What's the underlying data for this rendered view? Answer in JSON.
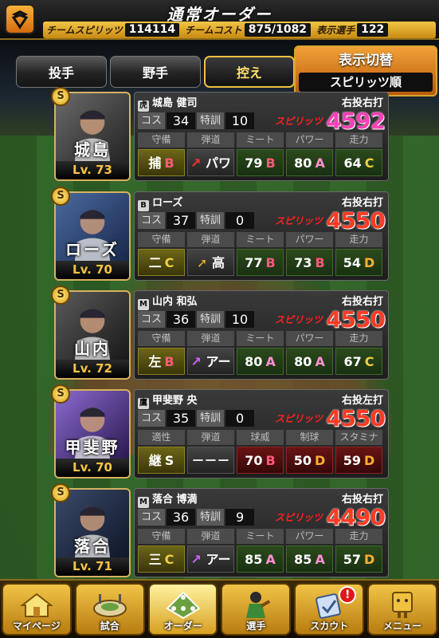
{
  "header": {
    "title": "通常オーダー",
    "team_spirits_label": "チームスピリッツ",
    "team_spirits_value": "114114",
    "team_cost_label": "チームコスト",
    "team_cost_value": "875/1082",
    "display_players_label": "表示選手",
    "display_players_value": "122"
  },
  "tabs": [
    {
      "label": "投手"
    },
    {
      "label": "野手"
    },
    {
      "label": "控え",
      "active": true
    }
  ],
  "sort_toggle": {
    "title": "表示切替",
    "value": "スピリッツ順"
  },
  "labels": {
    "cost": "コス",
    "training": "特訓",
    "spirits": "スピリッツ"
  },
  "players": [
    {
      "name": "城島",
      "level": "Lv. 73",
      "team_icon": "虎",
      "full_name": "城島 健司",
      "handedness": "右投右打",
      "cost": "34",
      "training": "10",
      "spirits": "4592",
      "spirits_color": "#ff3fb8",
      "headers": [
        "守備",
        "弾道",
        "ミート",
        "パワー",
        "走力"
      ],
      "values": [
        {
          "text": "捕",
          "grade": "B"
        },
        {
          "arrow": "↗",
          "text": "パワ"
        },
        {
          "text": "79",
          "grade": "B"
        },
        {
          "text": "80",
          "grade": "A"
        },
        {
          "text": "64",
          "grade": "C"
        }
      ]
    },
    {
      "name": "ローズ",
      "level": "Lv. 70",
      "team_icon": "B",
      "full_name": "ローズ",
      "handedness": "右投右打",
      "cost": "37",
      "training": "0",
      "spirits": "4550",
      "spirits_color": "#ff3b23",
      "headers": [
        "守備",
        "弾道",
        "ミート",
        "パワー",
        "走力"
      ],
      "values": [
        {
          "text": "二",
          "grade": "C"
        },
        {
          "arrow": "➚",
          "text": "高"
        },
        {
          "text": "77",
          "grade": "B"
        },
        {
          "text": "73",
          "grade": "B"
        },
        {
          "text": "54",
          "grade": "D"
        }
      ]
    },
    {
      "name": "山内",
      "level": "Lv. 72",
      "team_icon": "M",
      "full_name": "山内 和弘",
      "handedness": "右投右打",
      "cost": "36",
      "training": "10",
      "spirits": "4550",
      "spirits_color": "#ff3b23",
      "headers": [
        "守備",
        "弾道",
        "ミート",
        "パワー",
        "走力"
      ],
      "values": [
        {
          "text": "左",
          "grade": "B"
        },
        {
          "arrow": "↗",
          "text": "アー"
        },
        {
          "text": "80",
          "grade": "A"
        },
        {
          "text": "80",
          "grade": "A"
        },
        {
          "text": "67",
          "grade": "C"
        }
      ]
    },
    {
      "name": "甲斐野",
      "level": "Lv. 70",
      "team_icon": "鷹",
      "full_name": "甲斐野 央",
      "handedness": "右投左打",
      "cost": "35",
      "training": "0",
      "spirits": "4550",
      "spirits_color": "#ff3b23",
      "headers": [
        "適性",
        "弾道",
        "球威",
        "制球",
        "スタミナ"
      ],
      "values": [
        {
          "text": "継",
          "grade": "S"
        },
        {
          "text": "－－－"
        },
        {
          "text": "70",
          "grade": "B"
        },
        {
          "text": "50",
          "grade": "D"
        },
        {
          "text": "59",
          "grade": "D"
        }
      ]
    },
    {
      "name": "落合",
      "level": "Lv. 71",
      "team_icon": "M",
      "full_name": "落合 博満",
      "handedness": "右投右打",
      "cost": "36",
      "training": "9",
      "spirits": "4490",
      "spirits_color": "#ff3b23",
      "headers": [
        "守備",
        "弾道",
        "ミート",
        "パワー",
        "走力"
      ],
      "values": [
        {
          "text": "三",
          "grade": "C"
        },
        {
          "arrow": "↗",
          "text": "アー"
        },
        {
          "text": "85",
          "grade": "A"
        },
        {
          "text": "85",
          "grade": "A"
        },
        {
          "text": "57",
          "grade": "D"
        }
      ]
    }
  ],
  "nav": [
    {
      "label": "マイページ",
      "icon": "home-icon"
    },
    {
      "label": "試合",
      "icon": "stadium-icon"
    },
    {
      "label": "オーダー",
      "icon": "field-order-icon",
      "active": true
    },
    {
      "label": "選手",
      "icon": "player-icon"
    },
    {
      "label": "スカウト",
      "icon": "scout-icon",
      "badge": "!"
    },
    {
      "label": "メニュー",
      "icon": "menu-icon"
    }
  ]
}
